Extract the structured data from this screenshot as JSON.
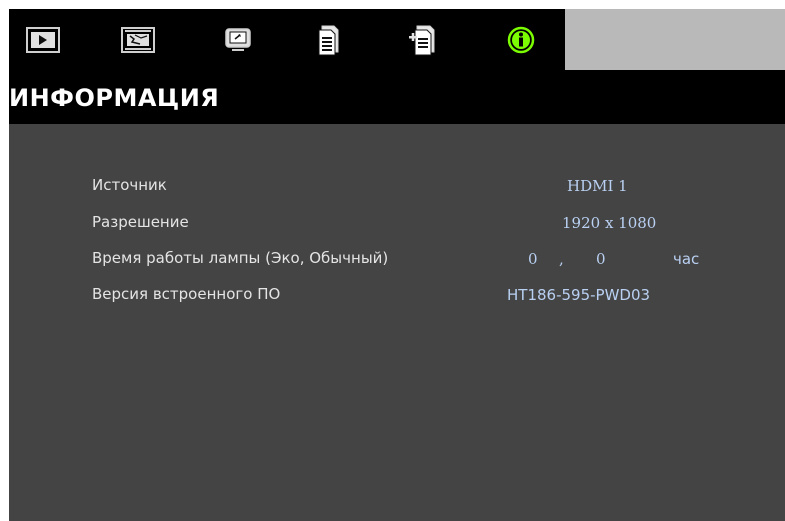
{
  "tabs": [
    {
      "name": "tab-picture",
      "icon": "video-play-icon",
      "active": false
    },
    {
      "name": "tab-image",
      "icon": "film-image-icon",
      "active": false
    },
    {
      "name": "tab-display",
      "icon": "display-screen-icon",
      "active": false
    },
    {
      "name": "tab-setup",
      "icon": "document-settings-icon",
      "active": false
    },
    {
      "name": "tab-options",
      "icon": "document-add-icon",
      "active": false
    },
    {
      "name": "tab-information",
      "icon": "info-icon",
      "active": true
    }
  ],
  "colors": {
    "active_icon": "#7CFC00",
    "value_text": "#b9d0f2",
    "label_text": "#e4e4e4",
    "panel_bg": "#444444"
  },
  "page": {
    "title": "ИНФОРМАЦИЯ"
  },
  "info": {
    "source": {
      "label": "Источник",
      "value": "HDMI 1"
    },
    "resolution": {
      "label": "Разрешение",
      "value": "1920 x 1080"
    },
    "lamp_hours": {
      "label": "Время работы лампы (Эко, Обычный)",
      "eco": "0",
      "separator": ",",
      "normal": "0",
      "unit": "час"
    },
    "firmware": {
      "label": "Версия встроенного ПО",
      "value": "HT186-595-PWD03"
    }
  }
}
